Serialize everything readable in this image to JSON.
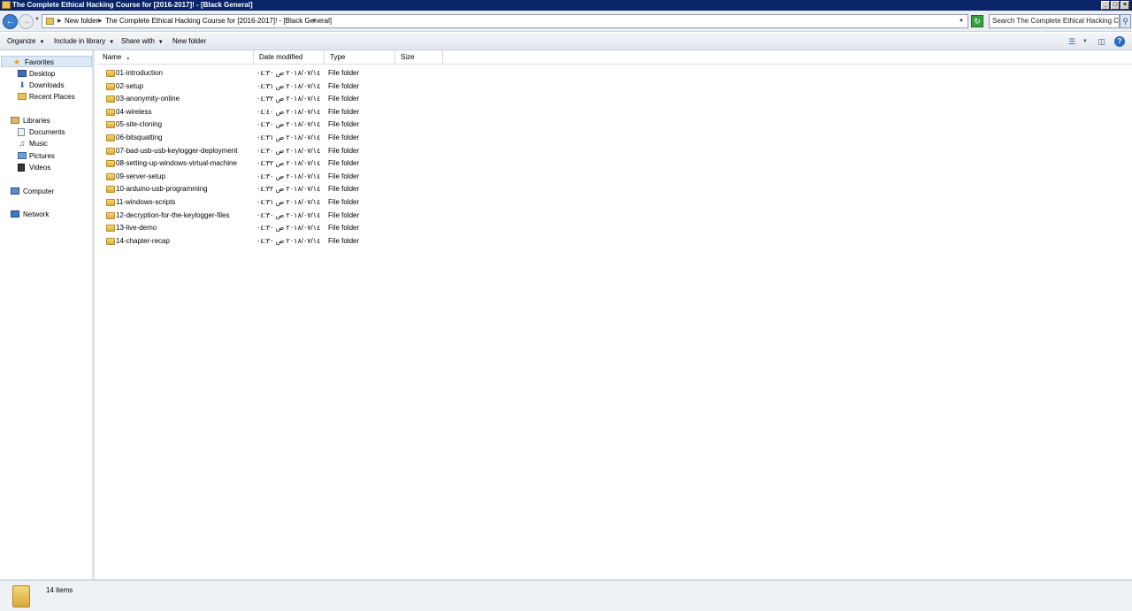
{
  "window": {
    "title": "The Complete Ethical Hacking Course for [2016-2017]! - [Black General]",
    "controls": {
      "minimize": "_",
      "maximize": "□",
      "close": "×"
    }
  },
  "address": {
    "crumbs": [
      "New folder",
      "The Complete Ethical Hacking Course for [2016-2017]! - [Black General]"
    ],
    "search_placeholder": "Search The Complete Ethical Hacking C..."
  },
  "toolbar": {
    "organize": "Organize",
    "include_in_library": "Include in library",
    "share_with": "Share with",
    "new_folder": "New folder"
  },
  "navpane": {
    "favorites": "Favorites",
    "desktop": "Desktop",
    "downloads": "Downloads",
    "recent_places": "Recent Places",
    "libraries": "Libraries",
    "documents": "Documents",
    "music": "Music",
    "pictures": "Pictures",
    "videos": "Videos",
    "computer": "Computer",
    "network": "Network"
  },
  "columns": {
    "name": "Name",
    "date_modified": "Date modified",
    "type": "Type",
    "size": "Size"
  },
  "files": [
    {
      "name": "01-introduction",
      "date": "٢٠١٨/٠٧/١٤ ص ٠٤:٣٠",
      "type": "File folder"
    },
    {
      "name": "02-setup",
      "date": "٢٠١٨/٠٧/١٤ ص ٠٤:٣١",
      "type": "File folder"
    },
    {
      "name": "03-anonymity-online",
      "date": "٢٠١٨/٠٧/١٤ ص ٠٤:٣٢",
      "type": "File folder"
    },
    {
      "name": "04-wireless",
      "date": "٢٠١٨/٠٧/١٤ ص ٠٤:٤٠",
      "type": "File folder"
    },
    {
      "name": "05-site-cloning",
      "date": "٢٠١٨/٠٧/١٤ ص ٠٤:٣٠",
      "type": "File folder"
    },
    {
      "name": "06-bitsquatting",
      "date": "٢٠١٨/٠٧/١٤ ص ٠٤:٣١",
      "type": "File folder"
    },
    {
      "name": "07-bad-usb-usb-keylogger-deployment",
      "date": "٢٠١٨/٠٧/١٤ ص ٠٤:٣٠",
      "type": "File folder"
    },
    {
      "name": "08-setting-up-windows-virtual-machine",
      "date": "٢٠١٨/٠٧/١٤ ص ٠٤:٣٢",
      "type": "File folder"
    },
    {
      "name": "09-server-setup",
      "date": "٢٠١٨/٠٧/١٤ ص ٠٤:٣٠",
      "type": "File folder"
    },
    {
      "name": "10-arduino-usb-programming",
      "date": "٢٠١٨/٠٧/١٤ ص ٠٤:٣٢",
      "type": "File folder"
    },
    {
      "name": "11-windows-scripts",
      "date": "٢٠١٨/٠٧/١٤ ص ٠٤:٣١",
      "type": "File folder"
    },
    {
      "name": "12-decryption-for-the-keylogger-files",
      "date": "٢٠١٨/٠٧/١٤ ص ٠٤:٣٠",
      "type": "File folder"
    },
    {
      "name": "13-live-demo",
      "date": "٢٠١٨/٠٧/١٤ ص ٠٤:٣٠",
      "type": "File folder"
    },
    {
      "name": "14-chapter-recap",
      "date": "٢٠١٨/٠٧/١٤ ص ٠٤:٣٠",
      "type": "File folder"
    }
  ],
  "status": {
    "item_count": "14 items"
  }
}
